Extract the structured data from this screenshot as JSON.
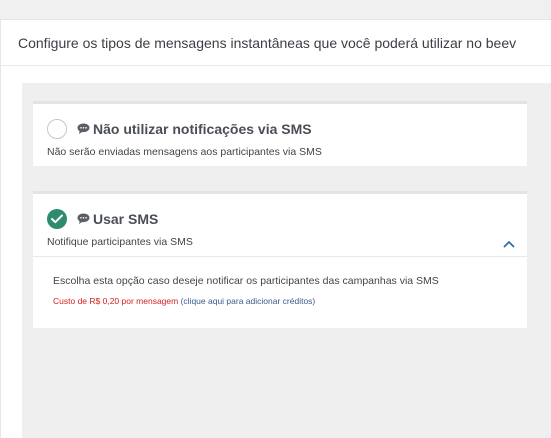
{
  "header": {
    "title": "Configure os tipos de mensagens instantâneas que você poderá utilizar no beev"
  },
  "options": [
    {
      "title": "Não utilizar notificações via SMS",
      "subtitle": "Não serão enviadas mensagens aos participantes via SMS",
      "selected": false,
      "icon": "chat-bubble-icon"
    },
    {
      "title": "Usar SMS",
      "subtitle": "Notifique participantes via SMS",
      "selected": true,
      "icon": "chat-bubble-icon",
      "expanded": true,
      "detail": "Escolha esta opção caso deseje notificar os participantes das campanhas via SMS",
      "cost_text": "Custo de R$ 0,20 por mensagem",
      "cost_link": "(clique aqui para adicionar créditos)"
    }
  ],
  "colors": {
    "selected_radio": "#2e8b6f",
    "cost_red": "#d62020",
    "link_blue": "#3a5a8c",
    "chevron_blue": "#2f6fb2"
  }
}
